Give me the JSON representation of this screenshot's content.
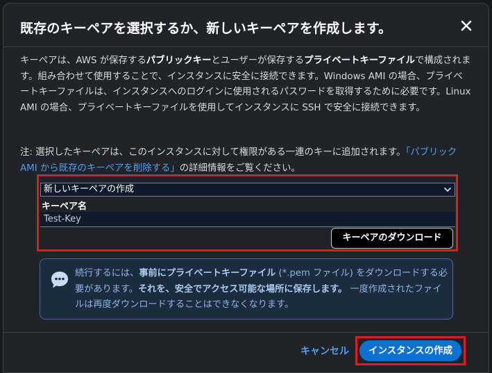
{
  "modal": {
    "title": "既存のキーペアを選択するか、新しいキーペアを作成します。"
  },
  "intro": {
    "t1": "キーペアは、AWS が保存する",
    "b1": "パブリックキー",
    "t2": "とユーザーが保存する",
    "b2": "プライベートキーファイル",
    "t3": "で構成されます。組み合わせて使用することで、インスタンスに安全に接続できます。Windows AMI の場合、プライベートキーファイルは、インスタンスへのログインに使用されるパスワードを取得するために必要です。Linux AMI の場合、プライベートキーファイルを使用してインスタンスに SSH で安全に接続できます。"
  },
  "note": {
    "t1": "注: 選択したキーペアは、このインスタンスに対して権限がある一連のキーに追加されます。",
    "link": "「パブリック AMI から既存のキーペアを削除する」",
    "t2": "の詳細情報をご覧ください。"
  },
  "form": {
    "select_value": "新しいキーペアの作成",
    "key_name_label": "キーペア名",
    "key_name_value": "Test-Key",
    "download_label": "キーペアのダウンロード"
  },
  "alert": {
    "t1": "続行するには、",
    "b1": "事前にプライベートキーファイル",
    "t2": " (*.pem ファイル) をダウンロードする必要があります。",
    "b2": "それを、安全でアクセス可能な場所に保存します。",
    "t3": " 一度作成されたファイルは再度ダウンロードすることはできなくなります。"
  },
  "footer": {
    "cancel_label": "キャンセル",
    "primary_label": "インスタンスの作成"
  },
  "colors": {
    "accent": "#0972d3",
    "link": "#539fe5",
    "highlight": "#e21b1b",
    "info": "#8db5e6"
  },
  "icons": [
    "close-icon",
    "chevron-down-icon",
    "info-chat-icon"
  ]
}
